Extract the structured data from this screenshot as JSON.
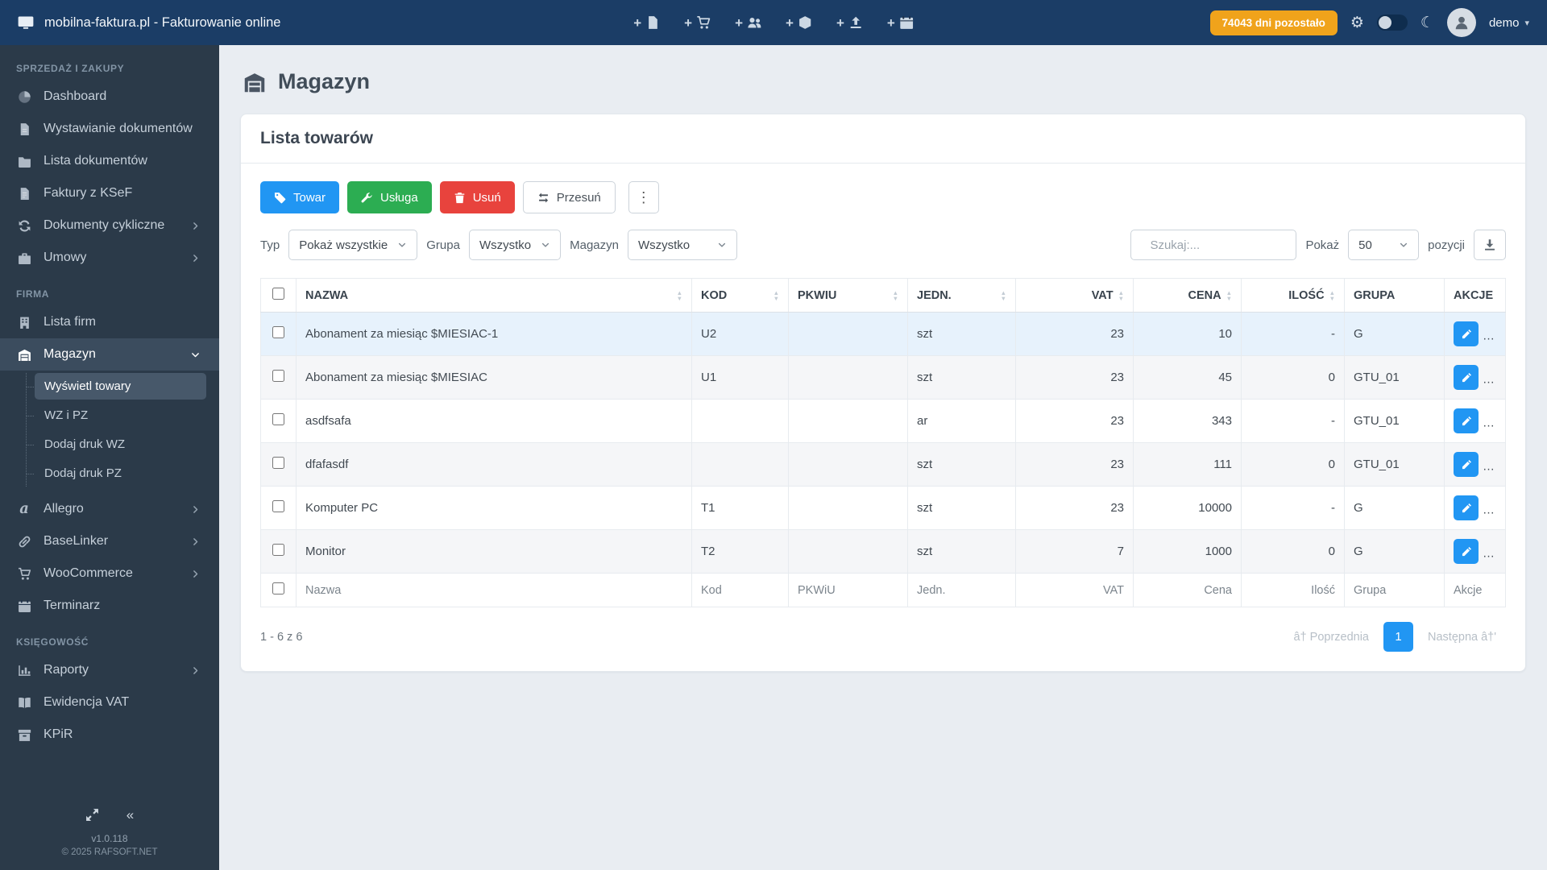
{
  "navbar": {
    "title": "mobilna-faktura.pl - Fakturowanie online",
    "badge": "74043 dni pozostało",
    "user": "demo",
    "quick_add": [
      {
        "icon": "file-icon"
      },
      {
        "icon": "cart-icon"
      },
      {
        "icon": "users-icon"
      },
      {
        "icon": "box-icon"
      },
      {
        "icon": "upload-icon"
      },
      {
        "icon": "calendar-icon"
      }
    ]
  },
  "sidebar": {
    "sections": [
      {
        "header": "SPRZEDAŻ I ZAKUPY",
        "items": [
          {
            "label": "Dashboard",
            "icon": "dashboard-icon"
          },
          {
            "label": "Wystawianie dokumentów",
            "icon": "file-pen-icon"
          },
          {
            "label": "Lista dokumentów",
            "icon": "folder-icon"
          },
          {
            "label": "Faktury z KSeF",
            "icon": "file-invoice-icon"
          },
          {
            "label": "Dokumenty cykliczne",
            "icon": "sync-icon",
            "chevron": "right"
          },
          {
            "label": "Umowy",
            "icon": "briefcase-icon",
            "chevron": "right"
          }
        ]
      },
      {
        "header": "FIRMA",
        "items": [
          {
            "label": "Lista firm",
            "icon": "building-icon"
          },
          {
            "label": "Magazyn",
            "icon": "warehouse-icon",
            "chevron": "down",
            "active": true,
            "submenu": [
              {
                "label": "Wyświetl towary",
                "active": true
              },
              {
                "label": "WZ i PZ"
              },
              {
                "label": "Dodaj druk WZ"
              },
              {
                "label": "Dodaj druk PZ"
              }
            ]
          },
          {
            "label": "Allegro",
            "icon": "allegro-icon",
            "chevron": "right"
          },
          {
            "label": "BaseLinker",
            "icon": "link-icon",
            "chevron": "right"
          },
          {
            "label": "WooCommerce",
            "icon": "cart-icon",
            "chevron": "right"
          },
          {
            "label": "Terminarz",
            "icon": "calendar-icon"
          }
        ]
      },
      {
        "header": "KSIĘGOWOŚĆ",
        "items": [
          {
            "label": "Raporty",
            "icon": "chart-icon",
            "chevron": "right"
          },
          {
            "label": "Ewidencja VAT",
            "icon": "book-icon"
          },
          {
            "label": "KPiR",
            "icon": "archive-icon"
          }
        ]
      }
    ],
    "version": "v1.0.118",
    "copyright": "© 2025 RAFSOFT.NET"
  },
  "page": {
    "title": "Magazyn",
    "card_title": "Lista towarów"
  },
  "toolbar": {
    "towar": "Towar",
    "usluga": "Usługa",
    "usun": "Usuń",
    "przesun": "Przesuń"
  },
  "filters": {
    "typ_label": "Typ",
    "typ_value": "Pokaż wszystkie",
    "grupa_label": "Grupa",
    "grupa_value": "Wszystko",
    "magazyn_label": "Magazyn",
    "magazyn_value": "Wszystko",
    "search_placeholder": "Szukaj:...",
    "pokaz_label": "Pokaż",
    "pokaz_value": "50",
    "pozycji_label": "pozycji"
  },
  "table": {
    "headers": [
      "NAZWA",
      "KOD",
      "PKWIU",
      "JEDN.",
      "VAT",
      "CENA",
      "ILOŚĆ",
      "GRUPA",
      "AKCJE"
    ],
    "footer": [
      "Nazwa",
      "Kod",
      "PKWiU",
      "Jedn.",
      "VAT",
      "Cena",
      "Ilość",
      "Grupa",
      "Akcje"
    ],
    "rows": [
      {
        "nazwa": "Abonament za miesiąc $MIESIAC-1",
        "kod": "U2",
        "pkwiu": "",
        "jedn": "szt",
        "vat": "23",
        "cena": "10",
        "ilosc": "-",
        "grupa": "G"
      },
      {
        "nazwa": "Abonament za miesiąc $MIESIAC",
        "kod": "U1",
        "pkwiu": "",
        "jedn": "szt",
        "vat": "23",
        "cena": "45",
        "ilosc": "0",
        "grupa": "GTU_01"
      },
      {
        "nazwa": "asdfsafa",
        "kod": "",
        "pkwiu": "",
        "jedn": "ar",
        "vat": "23",
        "cena": "343",
        "ilosc": "-",
        "grupa": "GTU_01"
      },
      {
        "nazwa": "dfafasdf",
        "kod": "",
        "pkwiu": "",
        "jedn": "szt",
        "vat": "23",
        "cena": "111",
        "ilosc": "0",
        "grupa": "GTU_01"
      },
      {
        "nazwa": "Komputer PC",
        "kod": "T1",
        "pkwiu": "",
        "jedn": "szt",
        "vat": "23",
        "cena": "10000",
        "ilosc": "-",
        "grupa": "G"
      },
      {
        "nazwa": "Monitor",
        "kod": "T2",
        "pkwiu": "",
        "jedn": "szt",
        "vat": "7",
        "cena": "1000",
        "ilosc": "0",
        "grupa": "G"
      }
    ]
  },
  "pagination": {
    "info": "1 - 6 z 6",
    "prev": "â† Poprzednia",
    "page": "1",
    "next": "Następna â†'"
  },
  "colors": {
    "navbar-bg": "#1b3d66",
    "sidebar-bg": "#2b3a49",
    "primary": "#2196f3",
    "success": "#2cad52",
    "danger": "#e8433d",
    "warning": "#f0a31b",
    "page-bg": "#e9edf2",
    "row-highlight": "#e7f2fc",
    "row-stripe": "#f5f6f8"
  }
}
